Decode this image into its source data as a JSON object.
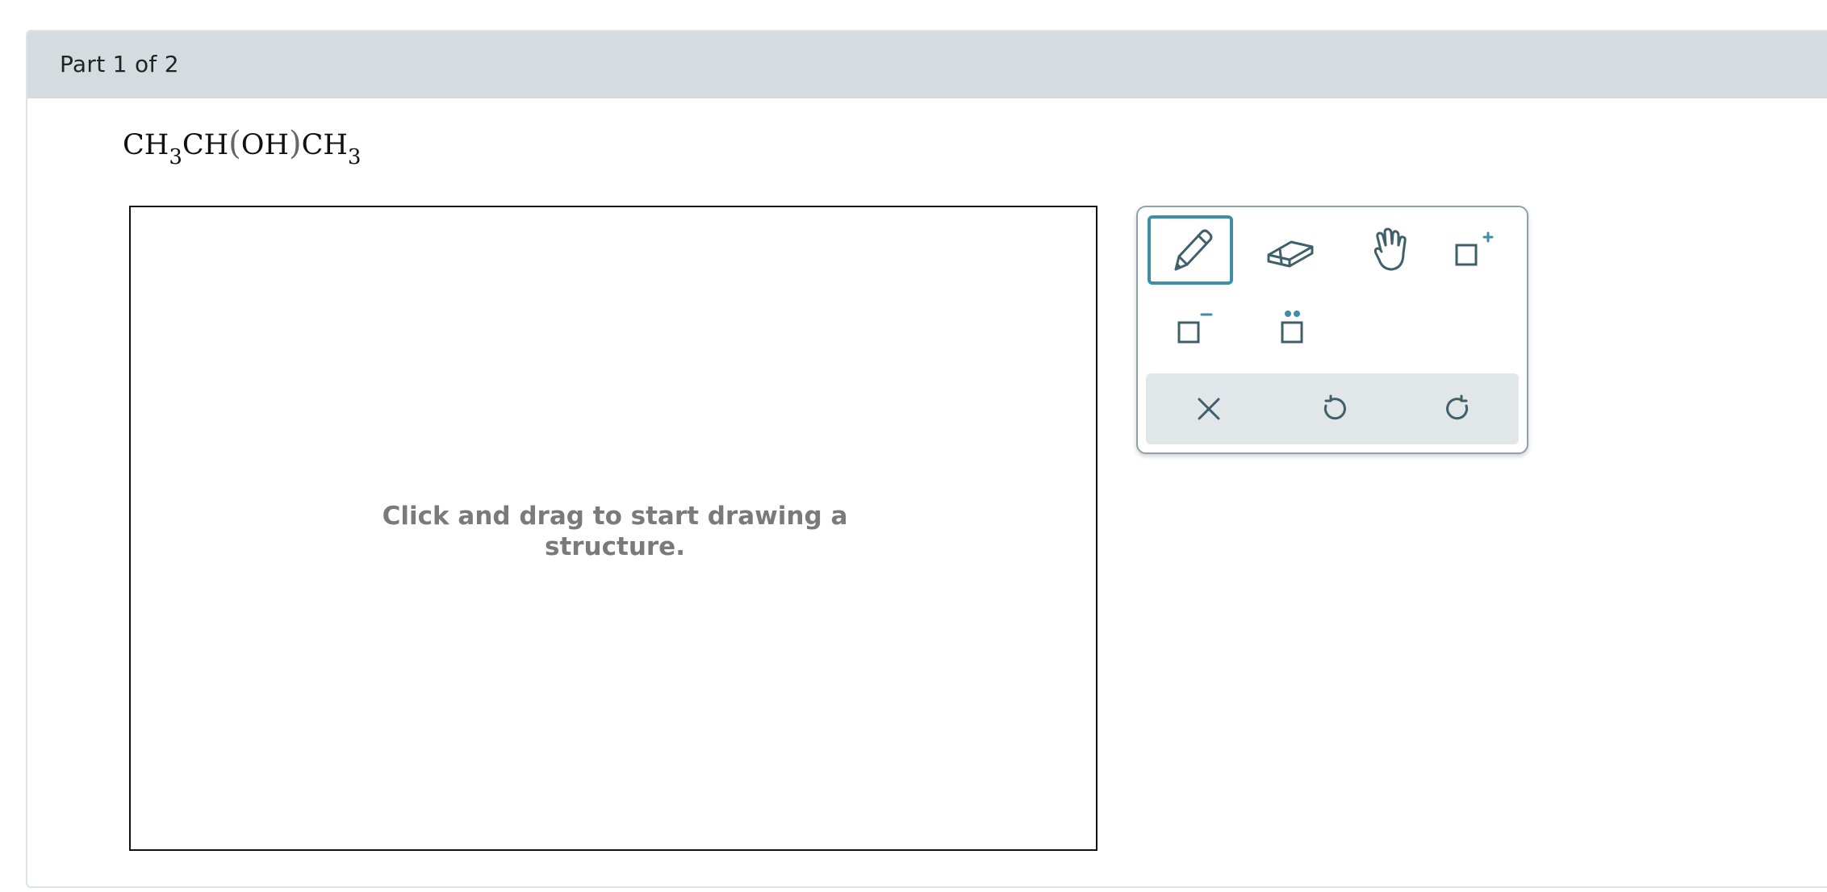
{
  "header": {
    "title": "Part 1 of 2"
  },
  "question": {
    "formula": {
      "p1": "CH",
      "s1": "3",
      "p2": "CH",
      "lparen": "(",
      "p3": "OH",
      "rparen": ")",
      "p4": "CH",
      "s2": "3"
    }
  },
  "canvas": {
    "hint": "Click and drag to start drawing a structure."
  },
  "toolbox": {
    "tools": [
      {
        "icon": "pencil-icon",
        "active": true
      },
      {
        "icon": "eraser-icon",
        "active": false
      },
      {
        "icon": "hand-icon",
        "active": false
      },
      {
        "icon": "positive-charge-icon",
        "active": false
      },
      {
        "icon": "negative-charge-icon",
        "active": false
      },
      {
        "icon": "lone-pair-icon",
        "active": false
      }
    ],
    "actions": [
      {
        "icon": "clear-icon"
      },
      {
        "icon": "undo-icon"
      },
      {
        "icon": "redo-icon"
      }
    ]
  },
  "colors": {
    "icon": "#3f5f6b",
    "accent": "#3d8ea6",
    "header_bg": "#d4dcdf",
    "hint_text": "#7a7a7a"
  }
}
